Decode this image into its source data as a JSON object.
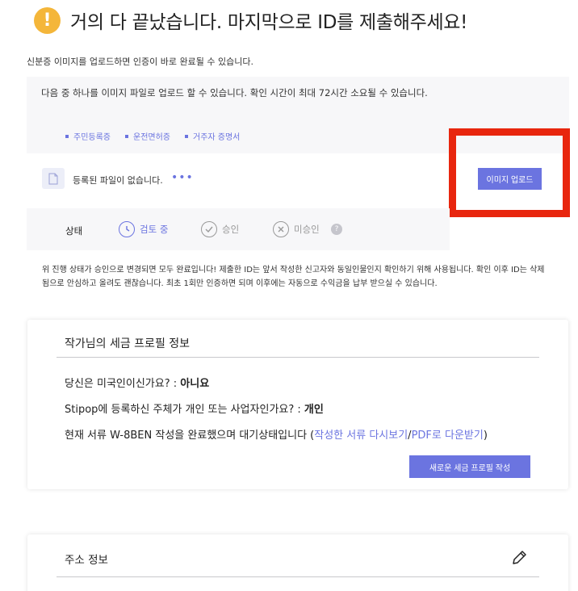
{
  "header": {
    "title": "거의 다 끝났습니다. 마지막으로 ID를 제출해주세요!"
  },
  "intro_text": "신분증 이미지를 업로드하면 인증이 바로 완료될 수 있습니다.",
  "documents": {
    "description": "다음 중 하나를 이미지 파일로 업로드 할 수 있습니다. 확인 시간이 최대 72시간 소요될 수 있습니다.",
    "types": [
      "주민등록증",
      "운전면허증",
      "거주자 증명서"
    ]
  },
  "upload": {
    "status_text": "등록된 파일이 없습니다.",
    "dots": "•••",
    "button_label": "이미지 업로드"
  },
  "status": {
    "label": "상태",
    "steps": [
      "검토 중",
      "승인",
      "미승인"
    ],
    "help": "?"
  },
  "notice": "위 진행 상태가 승인으로 변경되면 모두 완료입니다! 제출한 ID는 앞서 작성한 신고자와 동일인물인지 확인하기 위해 사용됩니다. 확인 이후 ID는 삭제 됨으로 안심하고 올려도 괜찮습니다. 최초 1회만 인증하면 되며 이후에는 자동으로 수익금을 납부 받으실 수 있습니다.",
  "tax_profile": {
    "title": "작가님의 세금 프로필 정보",
    "q1": "당신은 미국인이신가요? : ",
    "a1": "아니요",
    "q2": "Stipop에 등록하신 주체가 개인 또는 사업자인가요? : ",
    "a2": "개인",
    "q3_prefix": "현재 서류 W-8BEN 작성을 완료했으며 대기상태입니다 (",
    "q3_link1": "작성한 서류 다시보기",
    "q3_sep": "/",
    "q3_link2": "PDF로 다운받기",
    "q3_suffix": ")",
    "button_label": "새로운 세금 프로필 작성"
  },
  "address": {
    "title": "주소 정보"
  },
  "colors": {
    "accent": "#6b74e0",
    "warning": "#f4b63a",
    "highlight": "#e8260e"
  },
  "icons": {
    "warning": "exclamation-icon",
    "file": "file-icon",
    "review": "clock-icon",
    "approved": "check-icon",
    "rejected": "x-icon",
    "edit": "pencil-icon"
  }
}
